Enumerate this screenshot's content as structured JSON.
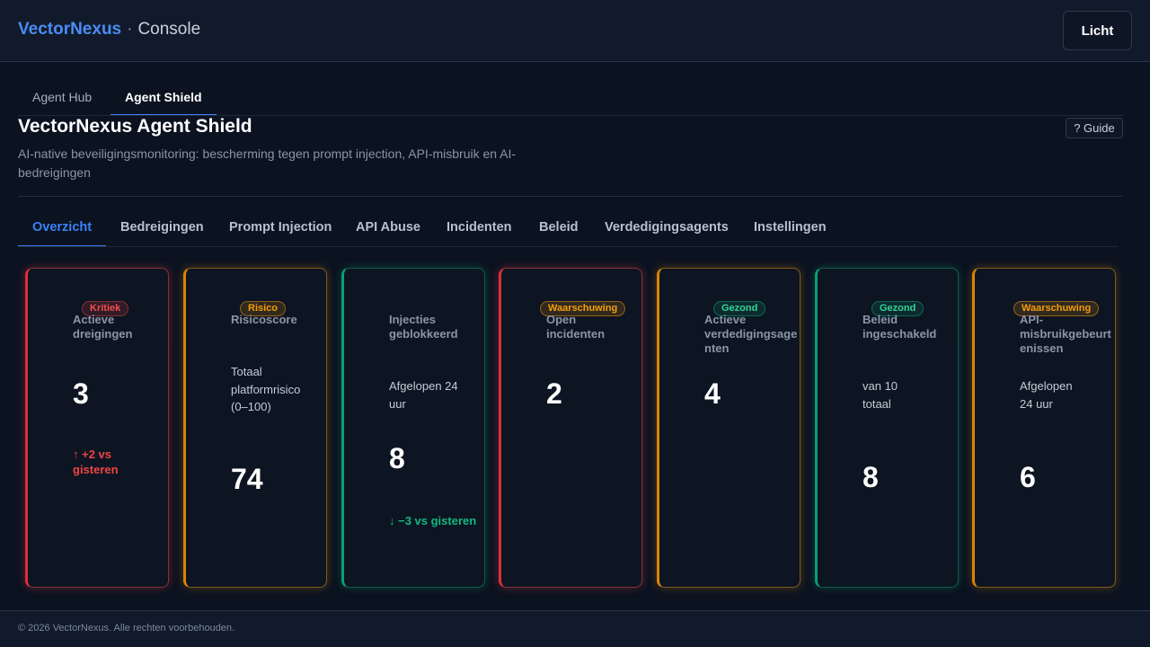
{
  "header": {
    "brand": "VectorNexus",
    "separator": "·",
    "section": "Console",
    "theme_button": "Licht"
  },
  "app_tabs": [
    {
      "label": "Agent Hub",
      "active": false
    },
    {
      "label": "Agent Shield",
      "active": true
    }
  ],
  "page": {
    "title": "VectorNexus Agent Shield",
    "subtitle": "AI-native beveiligingsmonitoring: bescherming tegen prompt injection, API-misbruik en AI-bedreigingen",
    "guide_button": "? Guide"
  },
  "section_tabs": [
    {
      "label": "Overzicht",
      "active": true
    },
    {
      "label": "Bedreigingen",
      "active": false
    },
    {
      "label": "Prompt Injection",
      "active": false
    },
    {
      "label": "API Abuse",
      "active": false
    },
    {
      "label": "Incidenten",
      "active": false
    },
    {
      "label": "Beleid",
      "active": false
    },
    {
      "label": "Verdedigingsagents",
      "active": false
    },
    {
      "label": "Instellingen",
      "active": false
    }
  ],
  "cards": [
    {
      "badge": "Kritiek",
      "status": "red",
      "label": "Actieve dreigingen",
      "subtitle": "",
      "value": "3",
      "trend": "↑ +2 vs gisteren",
      "trend_dir": "up"
    },
    {
      "badge": "Risico",
      "status": "orange",
      "label": "Risicoscore",
      "subtitle": "Totaal platformrisico (0–100)",
      "value": "74",
      "trend": "",
      "trend_dir": ""
    },
    {
      "badge": "",
      "status": "green",
      "label": "Injecties geblokkeerd",
      "subtitle": "Afgelopen 24 uur",
      "value": "8",
      "trend": "↓ −3 vs gisteren",
      "trend_dir": "down"
    },
    {
      "badge": "Waarschuwing",
      "status": "orange",
      "label": "Open incidenten",
      "subtitle": "",
      "value": "2",
      "trend": "",
      "trend_dir": ""
    },
    {
      "badge": "Gezond",
      "status": "green",
      "label": "Actieve verdedigingsagenten",
      "subtitle": "",
      "value": "4",
      "trend": "",
      "trend_dir": ""
    },
    {
      "badge": "Gezond",
      "status": "green",
      "label": "Beleid ingeschakeld",
      "subtitle": "van 10 totaal",
      "value": "8",
      "trend": "",
      "trend_dir": ""
    },
    {
      "badge": "Waarschuwing",
      "status": "orange",
      "label": "API-misbruikgebeurtenissen",
      "subtitle": "Afgelopen 24 uur",
      "value": "6",
      "trend": "",
      "trend_dir": ""
    }
  ],
  "footer": {
    "copyright": "© 2026 VectorNexus. Alle rechten voorbehouden."
  }
}
